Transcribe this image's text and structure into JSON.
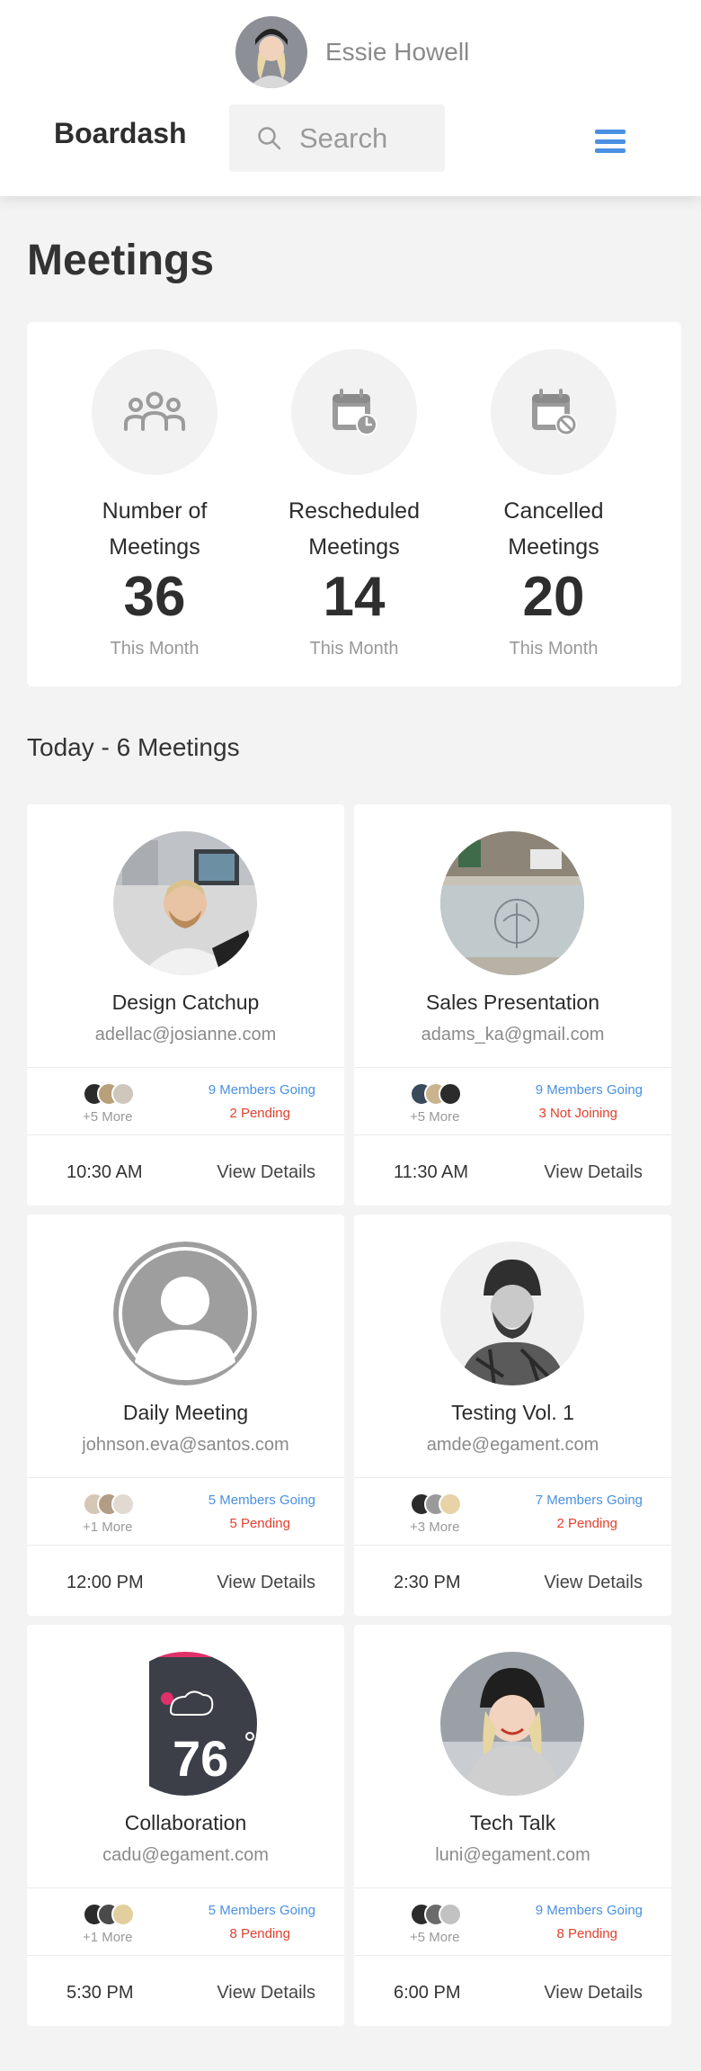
{
  "header": {
    "user_name": "Essie Howell",
    "brand": "Boardash",
    "search_placeholder": "Search"
  },
  "page_title": "Meetings",
  "stats": [
    {
      "label_line1": "Number of",
      "label_line2": "Meetings",
      "value": "36",
      "sub": "This Month",
      "icon": "people-icon"
    },
    {
      "label_line1": "Rescheduled",
      "label_line2": "Meetings",
      "value": "14",
      "sub": "This Month",
      "icon": "calendar-clock-icon"
    },
    {
      "label_line1": "Cancelled",
      "label_line2": "Meetings",
      "value": "20",
      "sub": "This Month",
      "icon": "calendar-cancel-icon"
    }
  ],
  "section_title": "Today - 6 Meetings",
  "meetings": [
    {
      "title": "Design Catchup",
      "email": "adellac@josianne.com",
      "more": "+5 More",
      "going": "9 Members Going",
      "status": "2 Pending",
      "time": "10:30 AM",
      "details": "View Details"
    },
    {
      "title": "Sales Presentation",
      "email": "adams_ka@gmail.com",
      "more": "+5 More",
      "going": "9 Members Going",
      "status": "3 Not Joining",
      "time": "11:30 AM",
      "details": "View Details"
    },
    {
      "title": "Daily Meeting",
      "email": "johnson.eva@santos.com",
      "more": "+1 More",
      "going": "5 Members Going",
      "status": "5 Pending",
      "time": "12:00 PM",
      "details": "View Details"
    },
    {
      "title": "Testing Vol. 1",
      "email": "amde@egament.com",
      "more": "+3 More",
      "going": "7 Members Going",
      "status": "2 Pending",
      "time": "2:30 PM",
      "details": "View Details"
    },
    {
      "title": "Collaboration",
      "email": "cadu@egament.com",
      "more": "+1 More",
      "going": "5 Members Going",
      "status": "8 Pending",
      "time": "5:30 PM",
      "details": "View Details",
      "photo_text": "76"
    },
    {
      "title": "Tech Talk",
      "email": "luni@egament.com",
      "more": "+5 More",
      "going": "9 Members Going",
      "status": "8 Pending",
      "time": "6:00 PM",
      "details": "View Details"
    }
  ],
  "colors": {
    "accent": "#4a90e2",
    "pending": "#e0412f",
    "background": "#f3f3f3"
  }
}
